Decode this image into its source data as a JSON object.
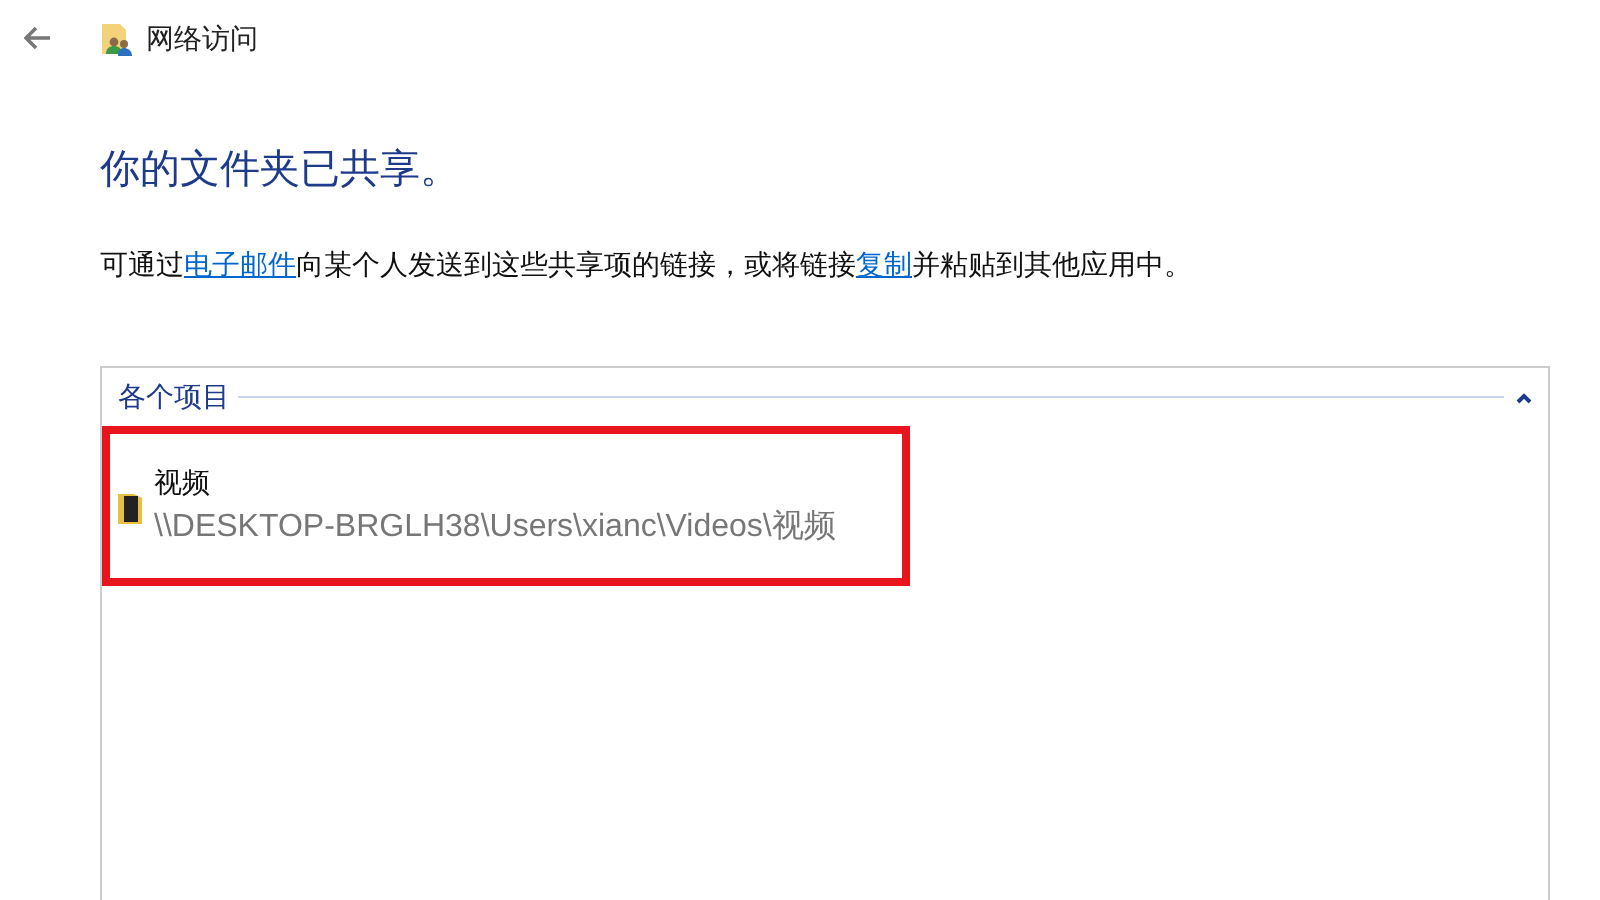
{
  "window": {
    "title": "网络访问"
  },
  "heading": "你的文件夹已共享。",
  "message": [
    {
      "kind": "text",
      "text": "可通过"
    },
    {
      "kind": "link",
      "text": "电子邮件"
    },
    {
      "kind": "text",
      "text": "向某个人发送到这些共享项的链接，或将链接"
    },
    {
      "kind": "link",
      "text": "复制"
    },
    {
      "kind": "text",
      "text": "并粘贴到其他应用中。"
    }
  ],
  "list": {
    "group": {
      "title": "各个项目",
      "expanded": true,
      "items": [
        {
          "name": "视频",
          "path": "\\\\DESKTOP-BRGLH38\\Users\\xianc\\Videos\\视频",
          "highlighted": true
        }
      ]
    }
  }
}
